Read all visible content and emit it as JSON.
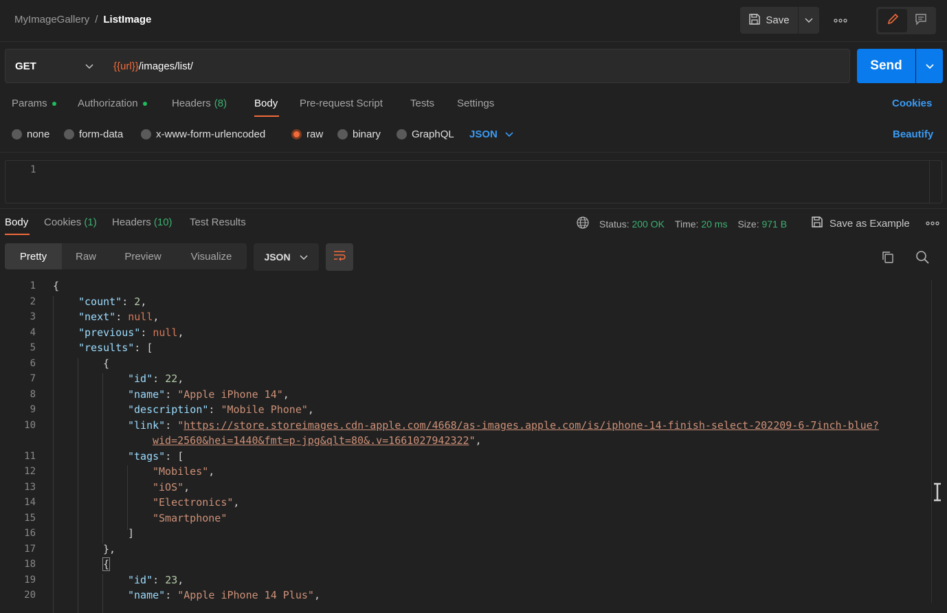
{
  "breadcrumb": {
    "collection": "MyImageGallery",
    "separator": "/",
    "request": "ListImage"
  },
  "toolbar": {
    "save_label": "Save"
  },
  "request": {
    "method": "GET",
    "url_variable": "{{url}}",
    "url_path": "/images/list/",
    "send_label": "Send"
  },
  "request_tabs": {
    "params": "Params",
    "authorization": "Authorization",
    "headers": "Headers",
    "headers_count": "(8)",
    "body": "Body",
    "prerequest": "Pre-request Script",
    "tests": "Tests",
    "settings": "Settings",
    "cookies": "Cookies"
  },
  "body_types": {
    "none": "none",
    "form_data": "form-data",
    "urlencoded": "x-www-form-urlencoded",
    "raw": "raw",
    "binary": "binary",
    "graphql": "GraphQL",
    "selected_format": "JSON",
    "beautify": "Beautify"
  },
  "request_editor": {
    "line1": "1"
  },
  "response_tabs": {
    "body": "Body",
    "cookies": "Cookies",
    "cookies_count": "(1)",
    "headers": "Headers",
    "headers_count": "(10)",
    "test_results": "Test Results"
  },
  "response_meta": {
    "status_label": "Status:",
    "status_value": "200 OK",
    "time_label": "Time:",
    "time_value": "20 ms",
    "size_label": "Size:",
    "size_value": "971 B",
    "save_example": "Save as Example"
  },
  "view_modes": {
    "pretty": "Pretty",
    "raw": "Raw",
    "preview": "Preview",
    "visualize": "Visualize",
    "format": "JSON"
  },
  "colors": {
    "accent_orange": "#f26b3a",
    "send_blue": "#097bed",
    "link_blue": "#3a9bf4",
    "status_green": "#3cb371"
  },
  "icons": [
    "save-icon",
    "chevron-down-icon",
    "more-horizontal-icon",
    "pencil-icon",
    "comment-icon",
    "globe-icon",
    "copy-icon",
    "search-icon",
    "wrap-lines-icon"
  ],
  "code": {
    "n1": "1",
    "n2": "2",
    "n3": "3",
    "n4": "4",
    "n5": "5",
    "n6": "6",
    "n7": "7",
    "n8": "8",
    "n9": "9",
    "n10": "10",
    "n11": "11",
    "n12": "12",
    "n13": "13",
    "n14": "14",
    "n15": "15",
    "n16": "16",
    "n17": "17",
    "n18": "18",
    "n19": "19",
    "n20": "20",
    "open_brace": "{",
    "count_key": "\"count\"",
    "count_val": "2",
    "next_key": "\"next\"",
    "next_val": "null",
    "previous_key": "\"previous\"",
    "previous_val": "null",
    "results_key": "\"results\"",
    "open_bracket": "[",
    "id1_key": "\"id\"",
    "id1_val": "22",
    "name1_key": "\"name\"",
    "name1_val": "\"Apple iPhone 14\"",
    "desc1_key": "\"description\"",
    "desc1_val": "\"Mobile Phone\"",
    "link1_key": "\"link\"",
    "link1_url_a": "https://store.storeimages.cdn-apple.com/4668/as-images.apple.com/is/iphone-14-finish-select-202209-6-7inch-blue?",
    "link1_url_b": "wid=2560&hei=1440&fmt=p-jpg&qlt=80&.v=1661027942322",
    "tags_key": "\"tags\"",
    "tag1": "\"Mobiles\"",
    "tag2": "\"iOS\"",
    "tag3": "\"Electronics\"",
    "tag4": "\"Smartphone\"",
    "close_bracket": "]",
    "close_obj": "},",
    "id2_key": "\"id\"",
    "id2_val": "23",
    "name2_key": "\"name\"",
    "name2_val": "\"Apple iPhone 14 Plus\""
  }
}
